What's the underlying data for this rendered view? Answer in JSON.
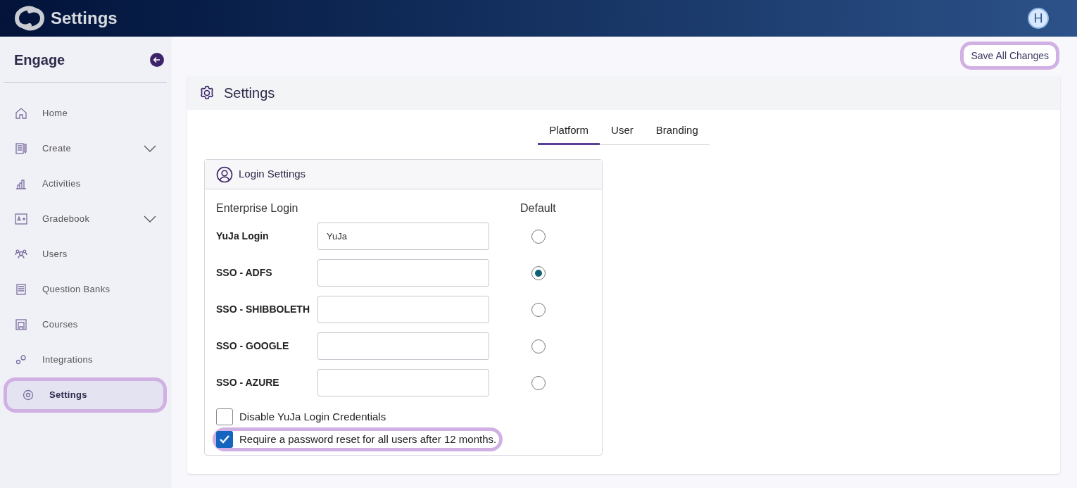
{
  "header": {
    "title": "Settings",
    "avatar": "H"
  },
  "sidebar": {
    "title": "Engage",
    "items": [
      {
        "label": "Home",
        "expandable": false,
        "selected": false,
        "highlighted": false
      },
      {
        "label": "Create",
        "expandable": true,
        "selected": false,
        "highlighted": false
      },
      {
        "label": "Activities",
        "expandable": false,
        "selected": false,
        "highlighted": false
      },
      {
        "label": "Gradebook",
        "expandable": true,
        "selected": false,
        "highlighted": false
      },
      {
        "label": "Users",
        "expandable": false,
        "selected": false,
        "highlighted": false
      },
      {
        "label": "Question Banks",
        "expandable": false,
        "selected": false,
        "highlighted": false
      },
      {
        "label": "Courses",
        "expandable": false,
        "selected": false,
        "highlighted": false
      },
      {
        "label": "Integrations",
        "expandable": false,
        "selected": false,
        "highlighted": false
      },
      {
        "label": "Settings",
        "expandable": false,
        "selected": true,
        "highlighted": true
      }
    ]
  },
  "save_button": {
    "label": "Save All Changes",
    "highlighted": true
  },
  "panel": {
    "title": "Settings",
    "tabs": [
      {
        "label": "Platform",
        "selected": true
      },
      {
        "label": "User",
        "selected": false
      },
      {
        "label": "Branding",
        "selected": false
      }
    ],
    "login_settings": {
      "title": "Login Settings",
      "column_1": "Enterprise Login",
      "column_3": "Default",
      "rows": [
        {
          "label": "YuJa Login",
          "value": "YuJa",
          "selected": false
        },
        {
          "label": "SSO - ADFS",
          "value": "",
          "selected": true
        },
        {
          "label": "SSO - SHIBBOLETH",
          "value": "",
          "selected": false
        },
        {
          "label": "SSO - GOOGLE",
          "value": "",
          "selected": false
        },
        {
          "label": "SSO - AZURE",
          "value": "",
          "selected": false
        }
      ],
      "options": [
        {
          "label": "Disable YuJa Login Credentials",
          "checked": false,
          "highlighted": false
        },
        {
          "label": "Require a password reset for all users after 12 months.",
          "checked": true,
          "highlighted": true
        }
      ]
    }
  }
}
